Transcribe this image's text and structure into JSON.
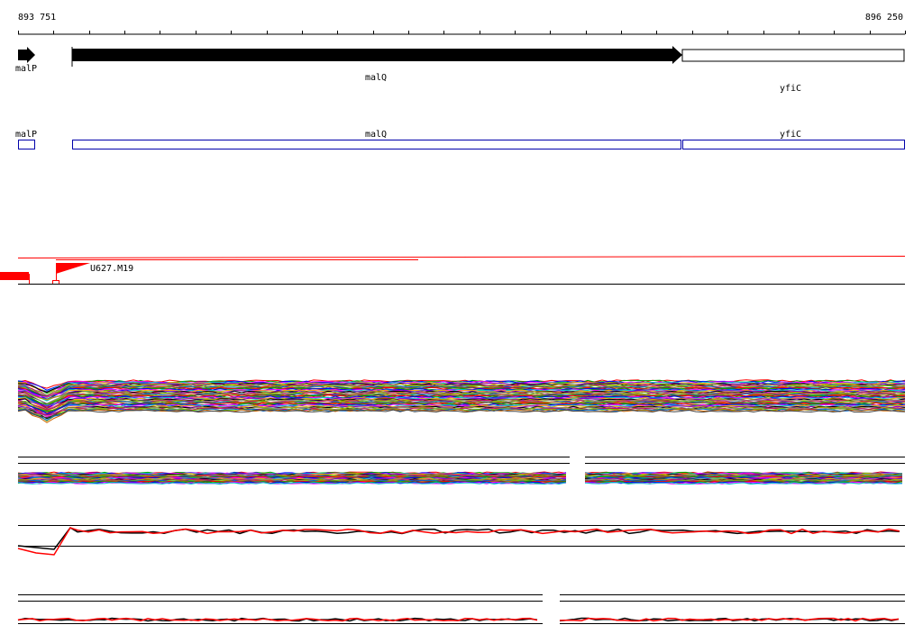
{
  "ruler": {
    "start_label": "893 751",
    "end_label": "896 250"
  },
  "genes": [
    {
      "name": "malP",
      "strand": "+",
      "style": "filled"
    },
    {
      "name": "malQ",
      "strand": "+",
      "style": "filled"
    },
    {
      "name": "yfiC",
      "strand": "+",
      "style": "open"
    }
  ],
  "annotation_boxes": [
    {
      "name": "malP"
    },
    {
      "name": "malQ"
    },
    {
      "name": "yfiC"
    }
  ],
  "feature_track": {
    "label": "U627.M19"
  },
  "colors": {
    "gene_fill": "#000000",
    "annotation_box": "#0000aa",
    "feature": "#ff0000",
    "line_palette": [
      "#ff0000",
      "#00aa00",
      "#0000ff",
      "#ff00ff",
      "#00cccc",
      "#ffaa00",
      "#8800cc",
      "#000000",
      "#aaaa00",
      "#888888",
      "#cc0066",
      "#66cc00",
      "#0066cc",
      "#cc6600",
      "#444444"
    ]
  },
  "tracks": [
    {
      "id": "multi-profile-track",
      "series_count": 60
    },
    {
      "id": "split-profile-track",
      "series_count": 35
    },
    {
      "id": "paired-profile-track",
      "series": [
        "black",
        "red"
      ]
    },
    {
      "id": "split-paired-profile-track",
      "series": [
        "black",
        "red"
      ]
    }
  ]
}
